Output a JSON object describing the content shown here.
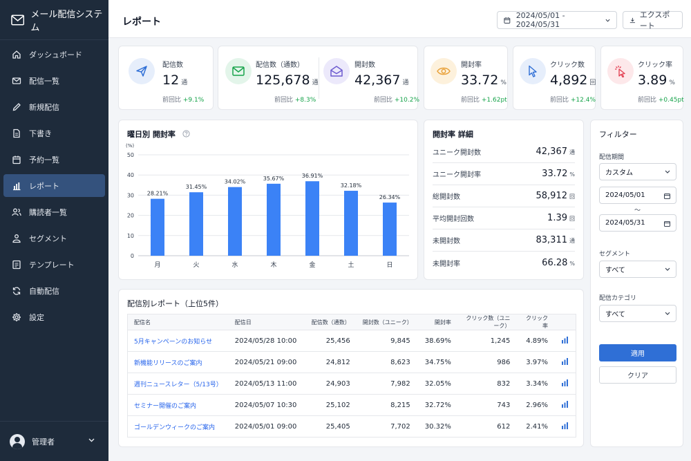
{
  "app": {
    "title": "メール配信システム"
  },
  "sidebar": {
    "items": [
      {
        "label": "ダッシュボード",
        "icon": "home-icon"
      },
      {
        "label": "配信一覧",
        "icon": "mail-icon"
      },
      {
        "label": "新規配信",
        "icon": "pencil-icon"
      },
      {
        "label": "下書き",
        "icon": "document-icon"
      },
      {
        "label": "予約一覧",
        "icon": "calendar-icon"
      },
      {
        "label": "レポート",
        "icon": "bar-chart-icon"
      },
      {
        "label": "購読者一覧",
        "icon": "users-icon"
      },
      {
        "label": "セグメント",
        "icon": "segment-icon"
      },
      {
        "label": "テンプレート",
        "icon": "template-icon"
      },
      {
        "label": "自動配信",
        "icon": "refresh-icon"
      },
      {
        "label": "設定",
        "icon": "gear-icon"
      }
    ],
    "active": 5
  },
  "user": {
    "name": "管理者"
  },
  "header": {
    "title": "レポート",
    "date_range": "2024/05/01 - 2024/05/31",
    "export_label": "エクスポート"
  },
  "kpis": [
    {
      "label": "配信数",
      "value": "12",
      "unit": "通",
      "cmp_label": "前回比",
      "cmp": "+9.1%"
    },
    {
      "label": "配信数（通数）",
      "value": "125,678",
      "unit": "通",
      "cmp_label": "前回比",
      "cmp": "+8.3%"
    },
    {
      "label": "開封数",
      "value": "42,367",
      "unit": "通",
      "cmp_label": "前回比",
      "cmp": "+10.2%"
    },
    {
      "label": "開封率",
      "value": "33.72",
      "unit": "%",
      "cmp_label": "前回比",
      "cmp": "+1.62pt"
    },
    {
      "label": "クリック数",
      "value": "4,892",
      "unit": "回",
      "cmp_label": "前回比",
      "cmp": "+12.4%"
    },
    {
      "label": "クリック率",
      "value": "3.89",
      "unit": "%",
      "cmp_label": "前回比",
      "cmp": "+0.45pt"
    }
  ],
  "chart_title": "曜日別 開封率",
  "chart_data": {
    "type": "bar",
    "title": "曜日別 開封率",
    "ylabel": "(%)",
    "categories": [
      "月",
      "火",
      "水",
      "木",
      "金",
      "土",
      "日"
    ],
    "values": [
      28.21,
      31.45,
      34.02,
      35.67,
      36.91,
      32.18,
      26.34
    ],
    "value_labels": [
      "28.21%",
      "31.45%",
      "34.02%",
      "35.67%",
      "36.91%",
      "32.18%",
      "26.34%"
    ],
    "ylim": [
      0,
      50
    ],
    "yticks": [
      "0",
      "10",
      "20",
      "30",
      "40",
      "50"
    ],
    "grid": true,
    "color": "#3b82f6"
  },
  "details": {
    "title": "開封率 詳細",
    "rows": [
      {
        "label": "ユニーク開封数",
        "value": "42,367",
        "unit": "通"
      },
      {
        "label": "ユニーク開封率",
        "value": "33.72",
        "unit": "%"
      },
      {
        "label": "総開封数",
        "value": "58,912",
        "unit": "回"
      },
      {
        "label": "平均開封回数",
        "value": "1.39",
        "unit": "回"
      },
      {
        "label": "未開封数",
        "value": "83,311",
        "unit": "通"
      },
      {
        "label": "未開封率",
        "value": "66.28",
        "unit": "%"
      }
    ]
  },
  "filter": {
    "title": "フィルター",
    "period_label": "配信期間",
    "period_value": "カスタム",
    "date_from": "2024/05/01",
    "tilde": "～",
    "date_to": "2024/05/31",
    "segment_label": "セグメント",
    "segment_value": "すべて",
    "category_label": "配信カテゴリ",
    "category_value": "すべて",
    "apply_label": "適用",
    "clear_label": "クリア"
  },
  "report": {
    "title": "配信別レポート（上位5件）",
    "columns": [
      "配信名",
      "配信日",
      "配信数（通数）",
      "開封数（ユニーク）",
      "開封率",
      "クリック数（ユニーク）",
      "クリック率"
    ],
    "rows": [
      [
        "5月キャンペーンのお知らせ",
        "2024/05/28 10:00",
        "25,456",
        "9,845",
        "38.69%",
        "1,245",
        "4.89%"
      ],
      [
        "新機能リリースのご案内",
        "2024/05/21 09:00",
        "24,812",
        "8,623",
        "34.75%",
        "986",
        "3.97%"
      ],
      [
        "週刊ニュースレター（5/13号）",
        "2024/05/13 11:00",
        "24,903",
        "7,982",
        "32.05%",
        "832",
        "3.34%"
      ],
      [
        "セミナー開催のご案内",
        "2024/05/07 10:30",
        "25,102",
        "8,215",
        "32.72%",
        "743",
        "2.96%"
      ],
      [
        "ゴールデンウィークのご案内",
        "2024/05/01 09:00",
        "25,405",
        "7,702",
        "30.32%",
        "612",
        "2.41%"
      ]
    ]
  },
  "colors": {
    "sidebar": "#1e2b3b",
    "active": "#34527d",
    "accent": "#2f6fd6",
    "positive": "#16a34a",
    "bar": "#3b82f6",
    "link": "#2563eb"
  }
}
